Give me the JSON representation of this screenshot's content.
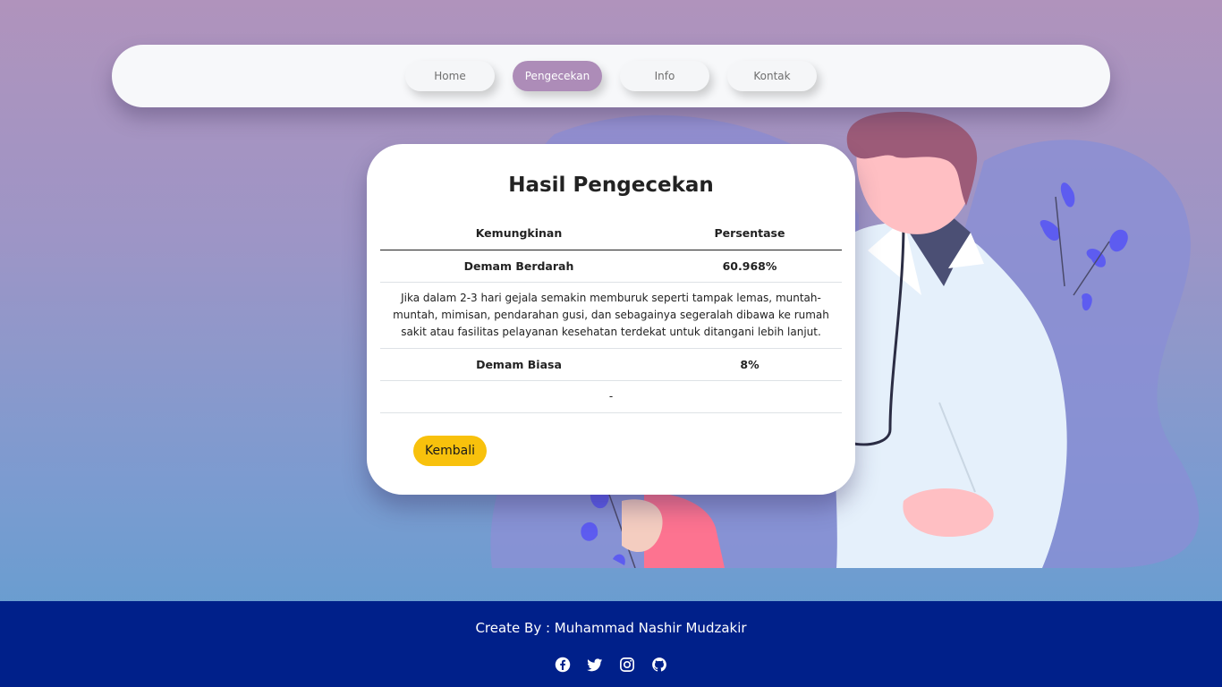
{
  "nav": {
    "items": [
      {
        "label": "Home",
        "active": false
      },
      {
        "label": "Pengecekan",
        "active": true
      },
      {
        "label": "Info",
        "active": false
      },
      {
        "label": "Kontak",
        "active": false
      }
    ]
  },
  "result": {
    "title": "Hasil Pengecekan",
    "columns": [
      "Kemungkinan",
      "Persentase"
    ],
    "rows": [
      {
        "name": "Demam Berdarah",
        "percent": "60.968%",
        "description": "Jika dalam 2-3 hari gejala semakin memburuk seperti tampak lemas, muntah-muntah, mimisan, pendarahan gusi, dan sebagainya segeralah dibawa ke rumah sakit atau fasilitas pelayanan kesehatan terdekat untuk ditangani lebih lanjut."
      },
      {
        "name": "Demam Biasa",
        "percent": "8%",
        "description": "-"
      }
    ],
    "back_label": "Kembali"
  },
  "footer": {
    "text": "Create By : Muhammad Nashir Mudzakir",
    "socials": [
      "facebook-icon",
      "twitter-icon",
      "instagram-icon",
      "github-icon"
    ]
  },
  "colors": {
    "accent": "#ad8cb8",
    "button": "#f8c10c",
    "footer": "#00208a"
  }
}
